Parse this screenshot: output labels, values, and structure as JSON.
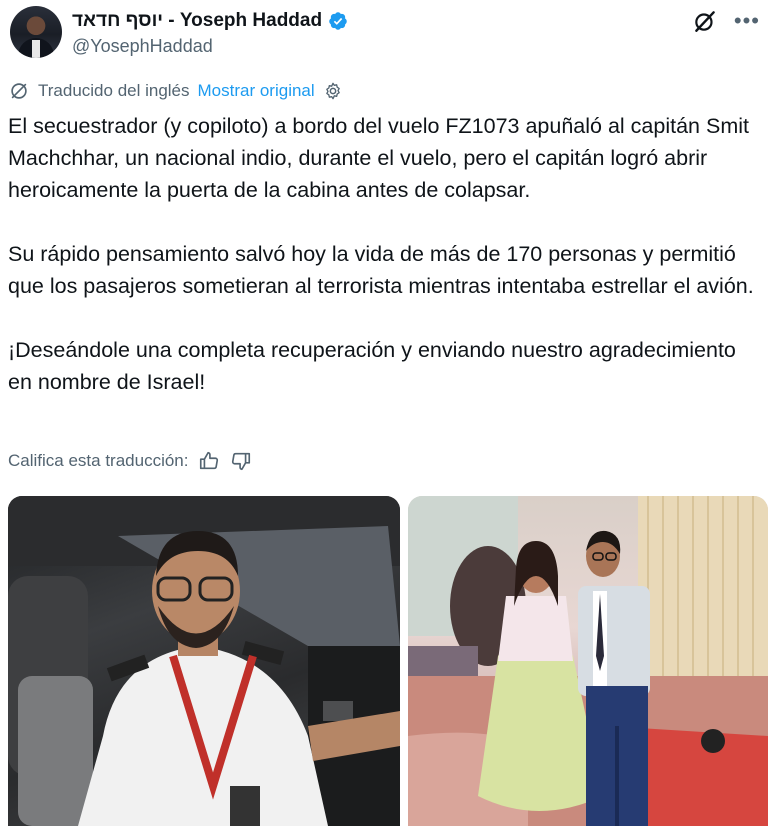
{
  "author": {
    "display_name": "יוסף חדאד - Yoseph Haddad",
    "handle": "@YosephHaddad"
  },
  "translation": {
    "label": "Traducido del inglés",
    "show_original": "Mostrar original"
  },
  "tweet": {
    "paragraphs": [
      "El secuestrador (y copiloto) a bordo del vuelo FZ1073 apuñaló al capitán Smit Machchhar, un nacional indio, durante el vuelo, pero el capitán logró abrir heroicamente la puerta de la cabina antes de colapsar.",
      "Su rápido pensamiento salvó hoy la vida de más de 170 personas y permitió que los pasajeros sometieran al terrorista mientras intentaba estrellar el avión.",
      "¡Deseándole una completa recuperación y enviando nuestro agradecimiento en nombre de Israel!"
    ]
  },
  "rating": {
    "label": "Califica esta traducción:"
  },
  "icons": {
    "verified": "verified-badge-icon",
    "grok": "grok-icon",
    "more": "more-icon",
    "translate": "translate-icon",
    "settings": "gear-icon",
    "thumbs_up": "thumbs-up-icon",
    "thumbs_down": "thumbs-down-icon"
  },
  "colors": {
    "text_primary": "#0f1419",
    "text_secondary": "#536471",
    "link": "#1d9bf0",
    "verified": "#1d9bf0"
  }
}
